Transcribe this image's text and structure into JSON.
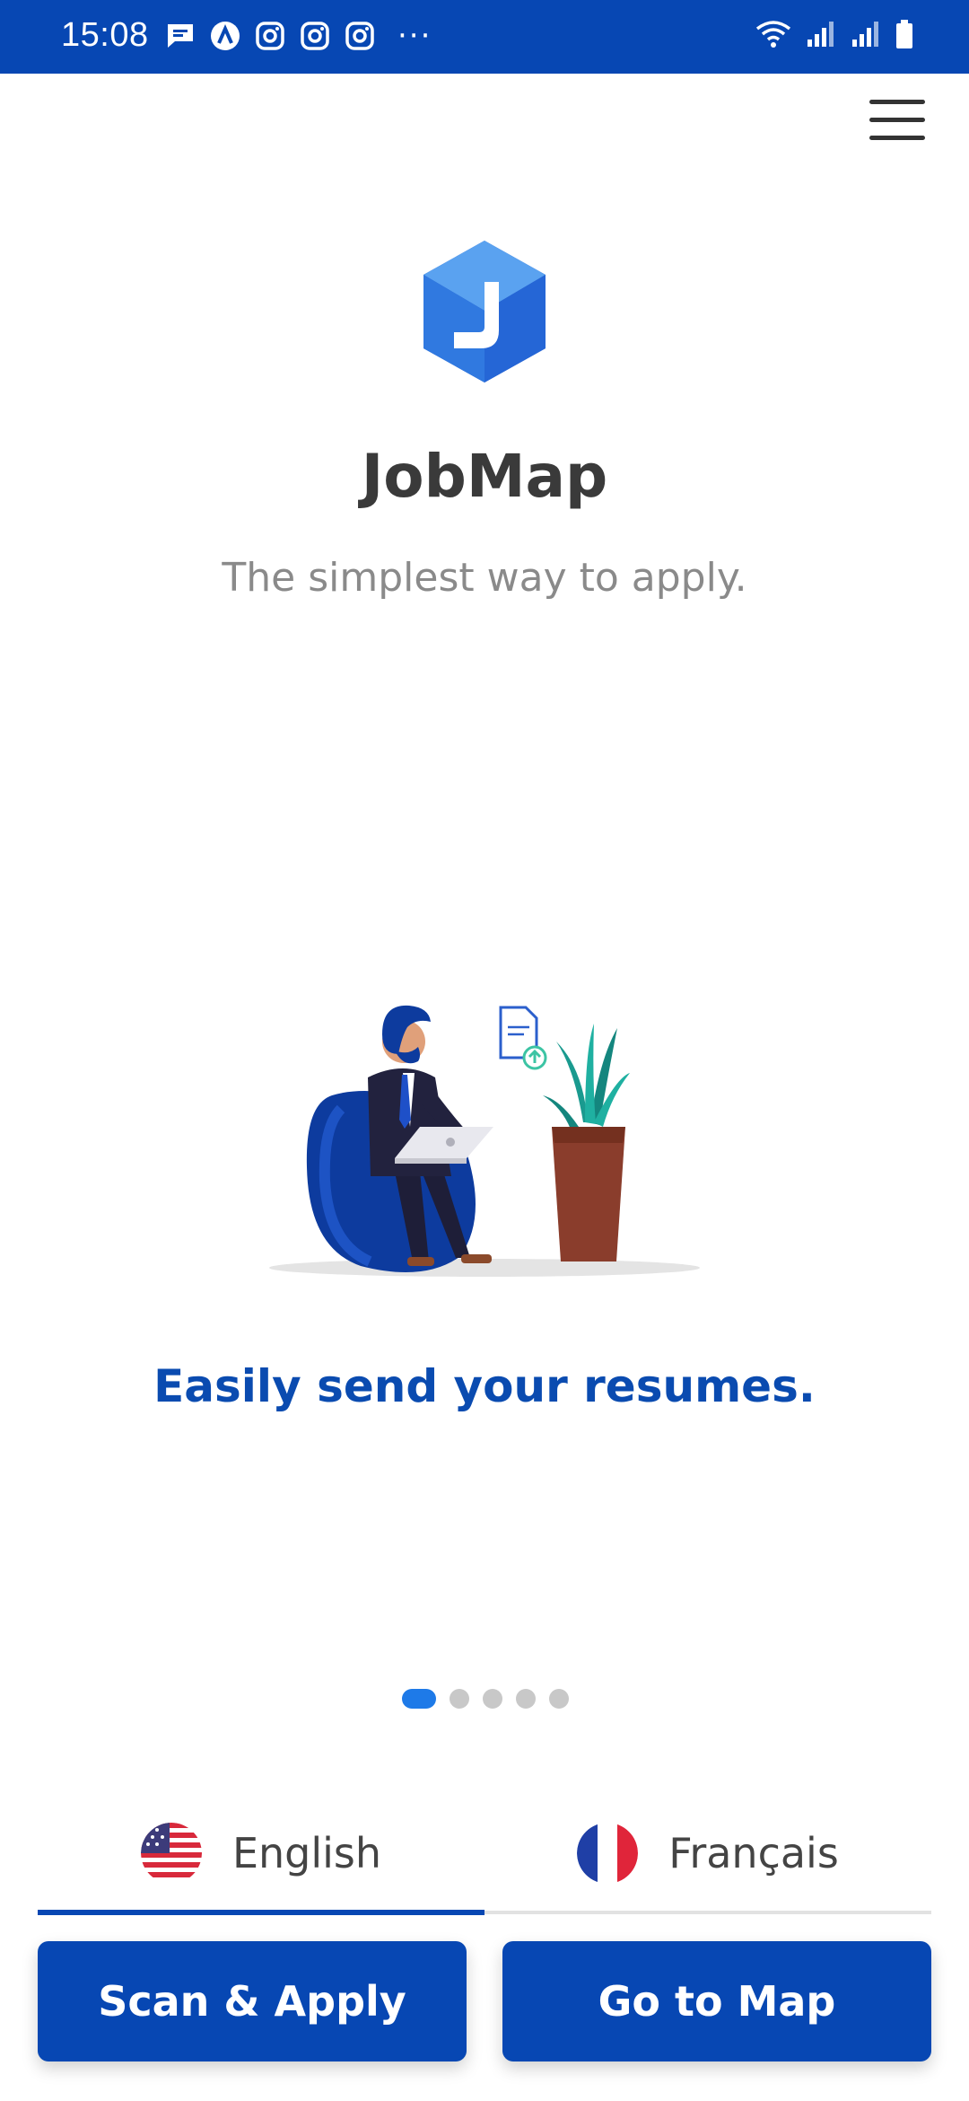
{
  "status_bar": {
    "time": "15:08",
    "left_icons": [
      "message-icon",
      "app-a-icon",
      "instagram-icon",
      "instagram-icon",
      "instagram-icon"
    ],
    "overflow": "···",
    "right_icons": [
      "wifi-icon",
      "signal-icon",
      "signal-icon",
      "battery-icon"
    ]
  },
  "header": {
    "menu_icon": "hamburger-menu-icon"
  },
  "app": {
    "title": "JobMap",
    "tagline": "The simplest way to apply."
  },
  "carousel": {
    "caption": "Easily send your resumes.",
    "page_count": 5,
    "active_index": 0
  },
  "language": {
    "options": [
      {
        "label": "English",
        "flag": "us-flag-icon"
      },
      {
        "label": "Français",
        "flag": "france-flag-icon"
      }
    ],
    "selected": "English"
  },
  "actions": {
    "scan_label": "Scan & Apply",
    "map_label": "Go to Map"
  },
  "colors": {
    "primary": "#0747b3",
    "caption": "#0a4bb0",
    "active_dot": "#1e7ae8",
    "inactive_dot": "#c8c8c8"
  }
}
